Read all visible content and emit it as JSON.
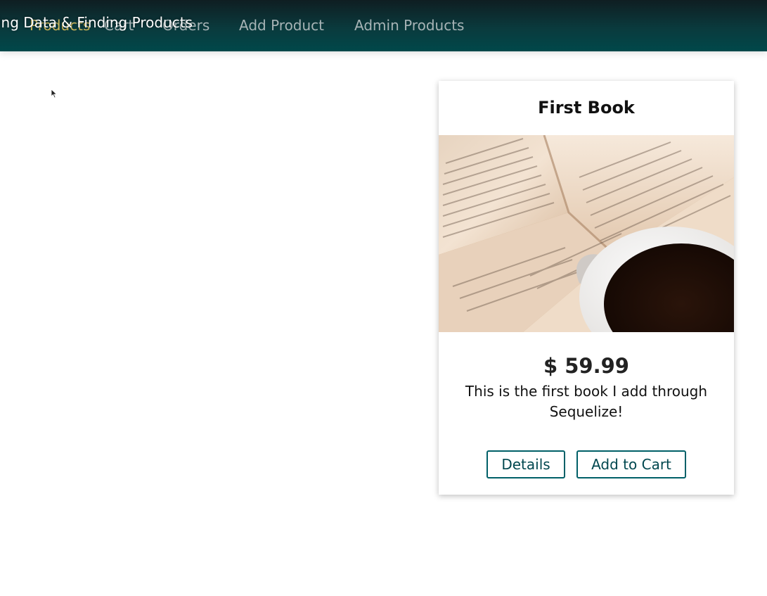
{
  "header": {
    "caption": "ing Data & Finding Products",
    "nav": [
      {
        "label": "Products",
        "active": true
      },
      {
        "label": "Cart",
        "active": false
      },
      {
        "label": "Orders",
        "active": false
      },
      {
        "label": "Add Product",
        "active": false
      },
      {
        "label": "Admin Products",
        "active": false
      }
    ]
  },
  "product": {
    "title": "First Book",
    "price": "$ 59.99",
    "description": "This is the first book I add through Sequelize!",
    "details_label": "Details",
    "add_to_cart_label": "Add to Cart",
    "image_alt": "open book with coffee cup"
  },
  "colors": {
    "header_bg": "#0a3a3d",
    "accent": "#006068",
    "active_nav": "#c9b45a"
  }
}
